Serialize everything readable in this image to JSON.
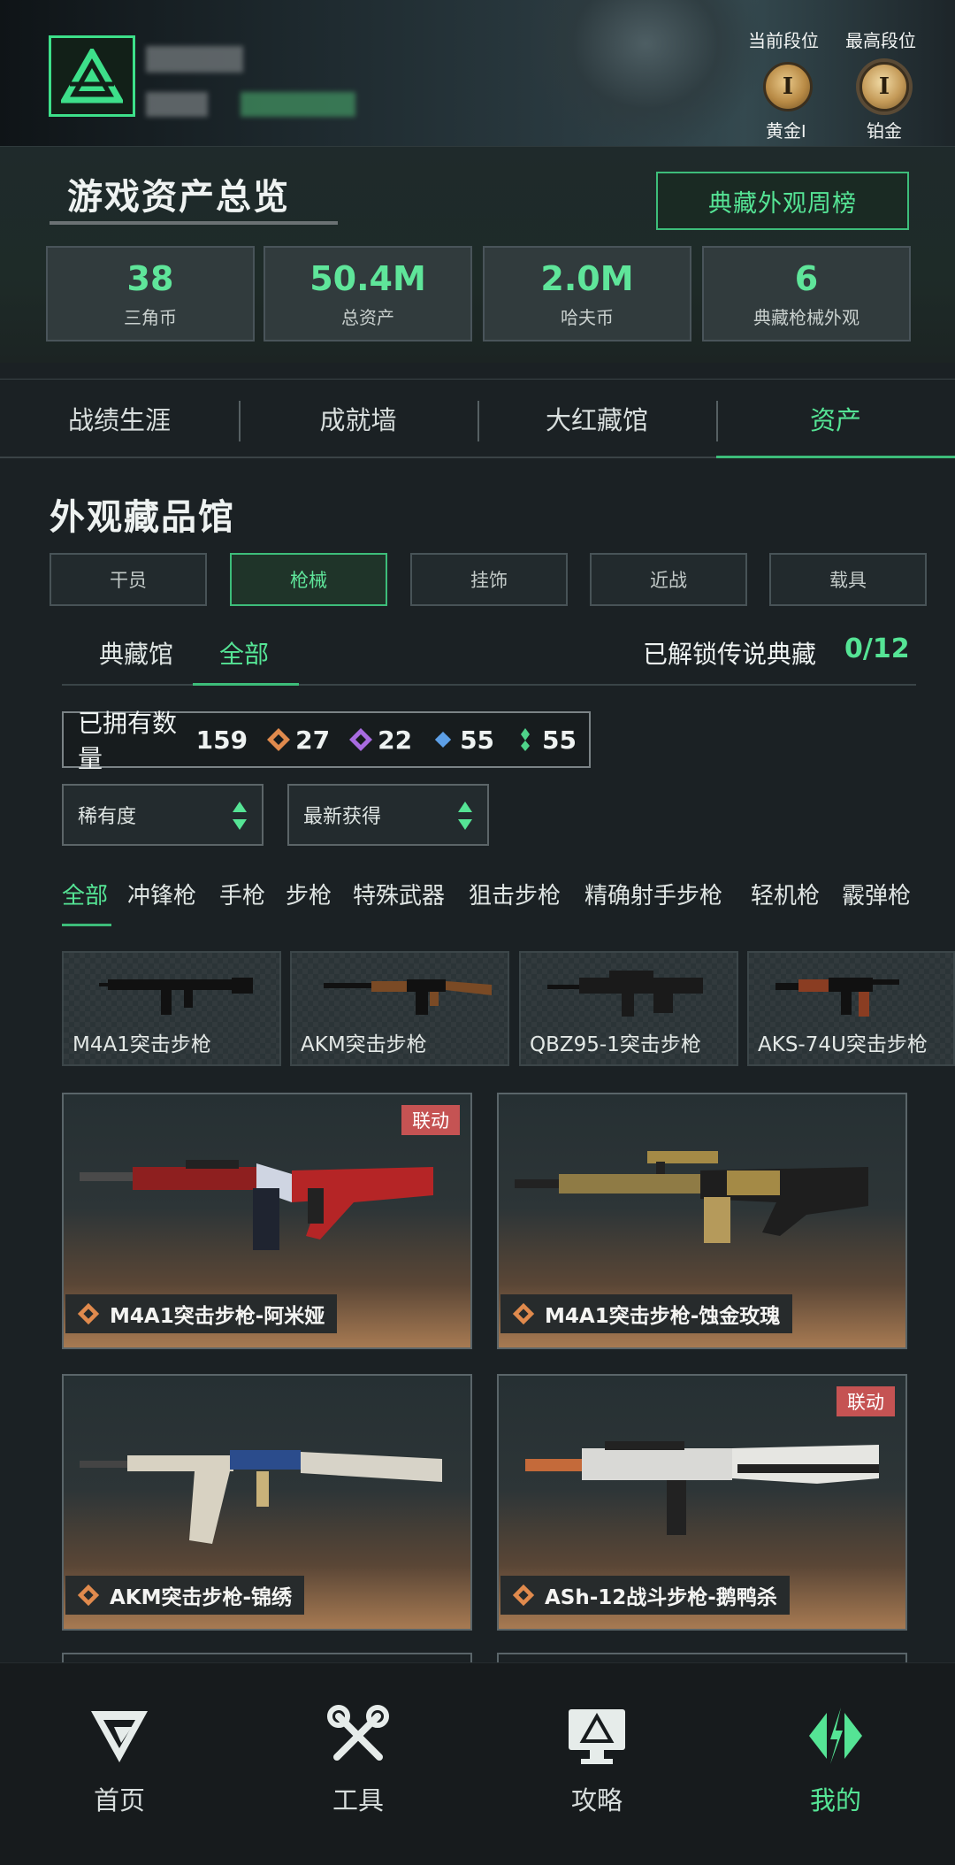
{
  "header": {
    "rank_current_label": "当前段位",
    "rank_highest_label": "最高段位",
    "rank_current": "黄金I",
    "rank_highest": "铂金",
    "rank_current_numeral": "I",
    "rank_highest_numeral": "I"
  },
  "overview": {
    "title": "游戏资产总览",
    "weekly_button": "典藏外观周榜",
    "stats": [
      {
        "value": "38",
        "label": "三角币"
      },
      {
        "value": "50.4M",
        "label": "总资产"
      },
      {
        "value": "2.0M",
        "label": "哈夫币"
      },
      {
        "value": "6",
        "label": "典藏枪械外观"
      }
    ]
  },
  "main_tabs": [
    "战绩生涯",
    "成就墙",
    "大红藏馆",
    "资产"
  ],
  "gallery": {
    "title": "外观藏品馆",
    "category_tabs": [
      "干员",
      "枪械",
      "挂饰",
      "近战",
      "载具"
    ],
    "sub_tabs": [
      "典藏馆",
      "全部"
    ],
    "legend_label": "已解锁传说典藏",
    "legend_count": "0/12",
    "owned_label": "已拥有数量",
    "owned_count": "159",
    "rarity_counts": [
      "27",
      "22",
      "55",
      "55"
    ],
    "sort_rarity": "稀有度",
    "sort_latest": "最新获得",
    "weapon_filters": [
      "全部",
      "冲锋枪",
      "手枪",
      "步枪",
      "特殊武器",
      "狙击步枪",
      "精确射手步枪",
      "轻机枪",
      "霰弹枪"
    ],
    "gun_types": [
      "M4A1突击步枪",
      "AKM突击步枪",
      "QBZ95-1突击步枪",
      "AKS-74U突击步枪"
    ],
    "skins": [
      {
        "name": "M4A1突击步枪-阿米娅",
        "tag": "联动"
      },
      {
        "name": "M4A1突击步枪-蚀金玫瑰",
        "tag": ""
      },
      {
        "name": "AKM突击步枪-锦绣",
        "tag": ""
      },
      {
        "name": "ASh-12战斗步枪-鹅鸭杀",
        "tag": "联动"
      }
    ]
  },
  "bottom_nav": [
    "首页",
    "工具",
    "攻略",
    "我的"
  ],
  "colors": {
    "accent": "#55e495",
    "collab": "#c55353",
    "background": "#1b2124"
  }
}
